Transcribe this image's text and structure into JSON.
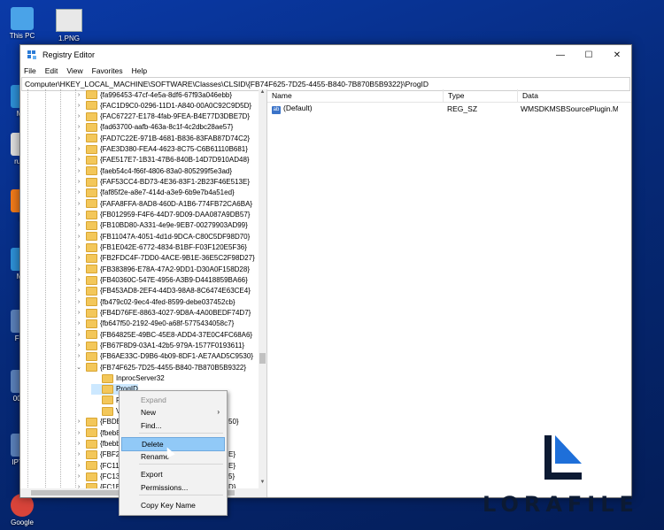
{
  "desktop": {
    "icons": [
      {
        "label": "This PC",
        "icon": "computer-icon"
      },
      {
        "label": "Mic",
        "icon": "edge-icon"
      },
      {
        "label": "rufus",
        "icon": "usb-icon"
      },
      {
        "label": "Fi",
        "icon": "firefox-icon"
      },
      {
        "label": "Mic",
        "icon": "edge-icon"
      },
      {
        "label": "Free",
        "icon": "app-icon"
      },
      {
        "label": "0009-",
        "icon": "app-icon"
      },
      {
        "label": "IPTVS",
        "icon": "app-icon"
      },
      {
        "label": "Google",
        "icon": "chrome-icon"
      }
    ],
    "file": {
      "label": "1.PNG",
      "icon": "image-file-icon"
    }
  },
  "window": {
    "title": "Registry Editor",
    "controls": {
      "minimize": "—",
      "maximize": "☐",
      "close": "✕"
    },
    "menu": [
      "File",
      "Edit",
      "View",
      "Favorites",
      "Help"
    ],
    "address": "Computer\\HKEY_LOCAL_MACHINE\\SOFTWARE\\Classes\\CLSID\\{FB74F625-7D25-4455-B840-7B870B5B9322}\\ProgID"
  },
  "tree": {
    "keys": [
      "{fa996453-47cf-4e5a-8df6-67f93a046ebb}",
      "{FAC1D9C0-0296-11D1-A840-00A0C92C9D5D}",
      "{FAC67227-E178-4fab-9FEA-B4E77D3DBE7D}",
      "{fad63700-aafb-463a-8c1f-4c2dbc28ae57}",
      "{FAD7C22E-971B-4681-B836-83FAB87D74C2}",
      "{FAE3D380-FEA4-4623-8C75-C6B61110B681}",
      "{FAE517E7-1B31-47B6-840B-14D7D910AD48}",
      "{faeb54c4-f66f-4806-83a0-805299f5e3ad}",
      "{FAF53CC4-BD73-4E36-83F1-2B23F46E513E}",
      "{faf85f2e-a8e7-414d-a3e9-6b9e7b4a51ed}",
      "{FAFA8FFA-8AD8-460D-A1B6-774FB72CA6BA}",
      "{FB012959-F4F6-44D7-9D09-DAA087A9DB57}",
      "{FB10BD80-A331-4e9e-9EB7-00279903AD99}",
      "{FB11047A-4051-4d1d-9DCA-C80C5DF98D70}",
      "{FB1E042E-6772-4834-B1BF-F03F120E5F36}",
      "{FB2FDC4F-7DD0-4ACE-9B1E-36E5C2F98D27}",
      "{FB383896-E78A-47A2-9DD1-D30A0F158D28}",
      "{FB40360C-547E-4956-A3B9-D4418859BA66}",
      "{FB453AD8-2EF4-44D3-98A8-8C6474E63CE4}",
      "{fb479c02-9ec4-4fed-8599-debe037452cb}",
      "{FB4D76FE-8863-4027-9D8A-4A00BEDF74D7}",
      "{fb647f50-2192-49e0-a68f-5775434058c7}",
      "{FB64825E-49BC-45E8-ADD4-37E0C4FC68A6}",
      "{FB67F8D9-03A1-42b5-979A-1577F0193611}",
      "{FB6AE33C-D9B6-4b09-8DF1-AE7AAD5C9530}",
      "{FB74F625-7D25-4455-B840-7B870B5B9322}"
    ],
    "subkeys": [
      "InprocServer32",
      "ProgID",
      "Prop",
      "Versi"
    ],
    "after": [
      "{FBDBD",
      "{fbeb8a",
      "{fbebb7",
      "{FBF23B",
      "{FC11EF",
      "{FC13A7",
      "{FC1EC1"
    ],
    "after_tails": [
      "50}",
      "",
      "",
      "E}",
      "E}",
      "5}",
      "D}"
    ]
  },
  "values": {
    "columns": [
      "Name",
      "Type",
      "Data"
    ],
    "rows": [
      {
        "name": "(Default)",
        "type": "REG_SZ",
        "data": "WMSDKMSBSourcePlugin.MSBD"
      }
    ]
  },
  "context_menu": {
    "items": [
      {
        "label": "Expand",
        "disabled": true
      },
      {
        "label": "New",
        "submenu": true
      },
      {
        "label": "Find..."
      },
      {
        "label": "Delete",
        "highlighted": true
      },
      {
        "label": "Rename"
      },
      {
        "label": "Export"
      },
      {
        "label": "Permissions..."
      },
      {
        "label": "Copy Key Name"
      }
    ],
    "submenu_arrow": "›"
  },
  "watermark": {
    "text": "LORAFILE",
    "color": "#0c1a33",
    "accent": "#1e6fd9"
  },
  "colors": {
    "selection": "#cce8ff",
    "menu_highlight": "#91c9f7",
    "folder": "#f3c75a"
  }
}
